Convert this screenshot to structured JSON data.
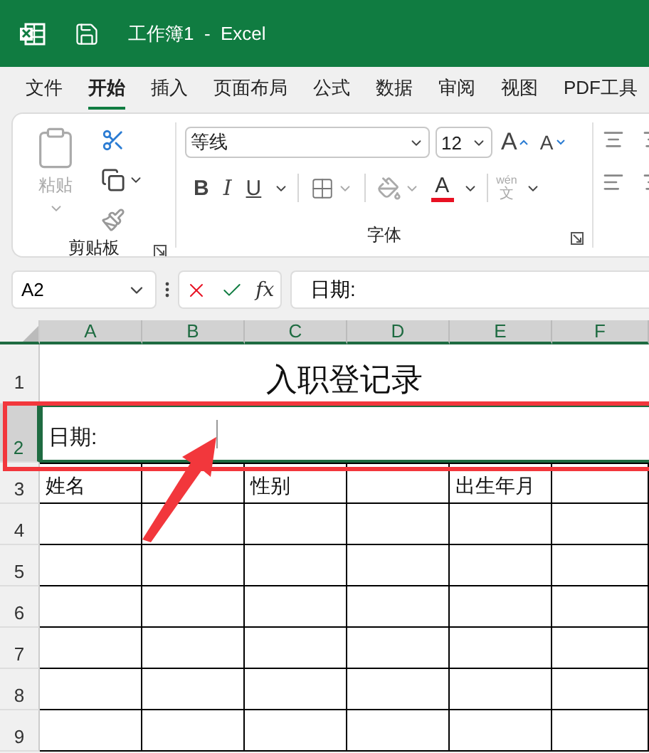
{
  "window": {
    "title": "工作簿1  -  Excel"
  },
  "tabs": [
    {
      "label": "文件",
      "selected": false
    },
    {
      "label": "开始",
      "selected": true
    },
    {
      "label": "插入",
      "selected": false
    },
    {
      "label": "页面布局",
      "selected": false
    },
    {
      "label": "公式",
      "selected": false
    },
    {
      "label": "数据",
      "selected": false
    },
    {
      "label": "审阅",
      "selected": false
    },
    {
      "label": "视图",
      "selected": false
    },
    {
      "label": "PDF工具",
      "selected": false
    }
  ],
  "ribbon": {
    "clipboard": {
      "label": "剪贴板",
      "paste": "粘贴",
      "paste_disabled": true
    },
    "font": {
      "label": "字体",
      "font_name": "等线",
      "font_size": "12",
      "grow": "A",
      "shrink": "A",
      "bold": "B",
      "italic": "I",
      "underline": "U",
      "font_color": "A",
      "phonetic_top": "wén",
      "phonetic_bottom": "文"
    }
  },
  "formula_bar": {
    "name_box": "A2",
    "fx": "fx",
    "formula": "日期:"
  },
  "columns": [
    "A",
    "B",
    "C",
    "D",
    "E",
    "F"
  ],
  "rows": [
    {
      "number": "1",
      "kind": "title",
      "selected": false,
      "text": "入职登记录"
    },
    {
      "number": "2",
      "kind": "merged",
      "selected": true,
      "text": "日期:"
    },
    {
      "number": "3",
      "kind": "grid",
      "selected": false,
      "cells": [
        "姓名",
        null,
        "性别",
        null,
        "出生年月",
        null
      ]
    },
    {
      "number": "4",
      "kind": "grid",
      "selected": false
    },
    {
      "number": "5",
      "kind": "grid",
      "selected": false
    },
    {
      "number": "6",
      "kind": "grid",
      "selected": false
    },
    {
      "number": "7",
      "kind": "grid",
      "selected": false
    },
    {
      "number": "8",
      "kind": "grid",
      "selected": false
    },
    {
      "number": "9",
      "kind": "grid",
      "selected": false
    }
  ]
}
